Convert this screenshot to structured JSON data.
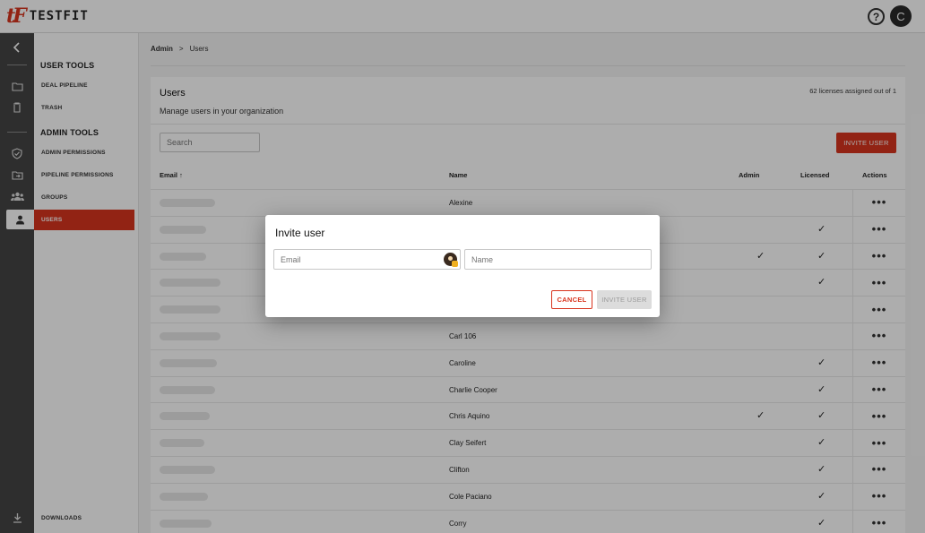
{
  "app": {
    "logo_mark": "tF",
    "logo_text": "TESTFIT",
    "help_label": "?",
    "avatar_initial": "C"
  },
  "rail": {
    "icons": [
      "collapse-chevron-icon",
      "folder-icon",
      "trash-icon",
      "shield-check-icon",
      "folder-move-icon",
      "groups-icon",
      "person-icon",
      "download-icon"
    ]
  },
  "sidebar": {
    "user_tools_heading": "USER TOOLS",
    "user_tools": [
      {
        "label": "DEAL PIPELINE"
      },
      {
        "label": "TRASH"
      }
    ],
    "admin_tools_heading": "ADMIN TOOLS",
    "admin_tools": [
      {
        "label": "ADMIN PERMISSIONS"
      },
      {
        "label": "PIPELINE PERMISSIONS"
      },
      {
        "label": "GROUPS"
      },
      {
        "label": "USERS",
        "active": true
      }
    ],
    "downloads_label": "DOWNLOADS"
  },
  "breadcrumb": {
    "root": "Admin",
    "separator": ">",
    "current": "Users"
  },
  "users_card": {
    "title": "Users",
    "subtitle": "Manage users in your organization",
    "license_text": "62 licenses assigned out of 1",
    "search_placeholder": "Search",
    "invite_button": "INVITE USER",
    "columns": {
      "email": "Email",
      "name": "Name",
      "admin": "Admin",
      "licensed": "Licensed",
      "actions": "Actions"
    },
    "rows": [
      {
        "name": "Alexine",
        "admin": false,
        "licensed": false
      },
      {
        "name": "",
        "admin": false,
        "licensed": true
      },
      {
        "name": "",
        "admin": true,
        "licensed": true
      },
      {
        "name": "",
        "admin": false,
        "licensed": true
      },
      {
        "name": "",
        "admin": false,
        "licensed": false
      },
      {
        "name": "Carl 106",
        "admin": false,
        "licensed": false
      },
      {
        "name": "Caroline",
        "admin": false,
        "licensed": true
      },
      {
        "name": "Charlie Cooper",
        "admin": false,
        "licensed": true
      },
      {
        "name": "Chris Aquino",
        "admin": true,
        "licensed": true
      },
      {
        "name": "Clay Seifert",
        "admin": false,
        "licensed": true
      },
      {
        "name": "Clifton",
        "admin": false,
        "licensed": true
      },
      {
        "name": "Cole Paciano",
        "admin": false,
        "licensed": true
      },
      {
        "name": "Corry",
        "admin": false,
        "licensed": true
      }
    ],
    "check_glyph": "✓",
    "actions_glyph": "•••",
    "sort_glyph": "↑"
  },
  "modal": {
    "title": "Invite user",
    "email_placeholder": "Email",
    "name_placeholder": "Name",
    "cancel_label": "CANCEL",
    "invite_label": "INVITE USER"
  },
  "colors": {
    "brand": "#d8341e",
    "rail": "#454545"
  }
}
